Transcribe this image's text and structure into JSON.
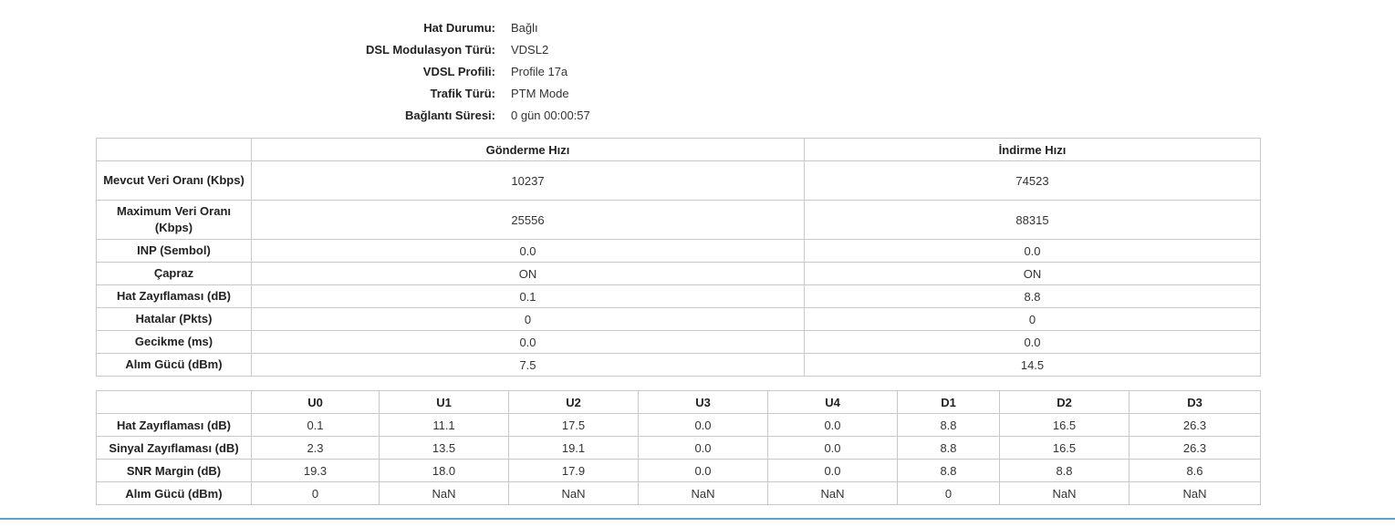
{
  "status": {
    "rows": [
      {
        "label": "Hat Durumu:",
        "value": "Bağlı"
      },
      {
        "label": "DSL Modulasyon Türü:",
        "value": "VDSL2"
      },
      {
        "label": "VDSL Profili:",
        "value": "Profile 17a"
      },
      {
        "label": "Trafik Türü:",
        "value": "PTM Mode"
      },
      {
        "label": "Bağlantı Süresi:",
        "value": "0 gün 00:00:57"
      }
    ]
  },
  "rate_table": {
    "headers": [
      "",
      "Gönderme Hızı",
      "İndirme Hızı"
    ],
    "rows": [
      {
        "label": "Mevcut Veri Oranı (Kbps)",
        "up": "10237",
        "down": "74523"
      },
      {
        "label": "Maximum Veri Oranı (Kbps)",
        "up": "25556",
        "down": "88315"
      },
      {
        "label": "INP (Sembol)",
        "up": "0.0",
        "down": "0.0"
      },
      {
        "label": "Çapraz",
        "up": "ON",
        "down": "ON"
      },
      {
        "label": "Hat Zayıflaması (dB)",
        "up": "0.1",
        "down": "8.8"
      },
      {
        "label": "Hatalar (Pkts)",
        "up": "0",
        "down": "0"
      },
      {
        "label": "Gecikme (ms)",
        "up": "0.0",
        "down": "0.0"
      },
      {
        "label": "Alım Gücü (dBm)",
        "up": "7.5",
        "down": "14.5"
      }
    ]
  },
  "tone_table": {
    "headers": [
      "",
      "U0",
      "U1",
      "U2",
      "U3",
      "U4",
      "D1",
      "D2",
      "D3"
    ],
    "rows": [
      {
        "label": "Hat Zayıflaması (dB)",
        "values": [
          "0.1",
          "11.1",
          "17.5",
          "0.0",
          "0.0",
          "8.8",
          "16.5",
          "26.3"
        ]
      },
      {
        "label": "Sinyal Zayıflaması (dB)",
        "values": [
          "2.3",
          "13.5",
          "19.1",
          "0.0",
          "0.0",
          "8.8",
          "16.5",
          "26.3"
        ]
      },
      {
        "label": "SNR Margin (dB)",
        "values": [
          "19.3",
          "18.0",
          "17.9",
          "0.0",
          "0.0",
          "8.8",
          "8.8",
          "8.6"
        ]
      },
      {
        "label": "Alım Gücü (dBm)",
        "values": [
          "0",
          "NaN",
          "NaN",
          "NaN",
          "NaN",
          "0",
          "NaN",
          "NaN"
        ]
      }
    ]
  }
}
